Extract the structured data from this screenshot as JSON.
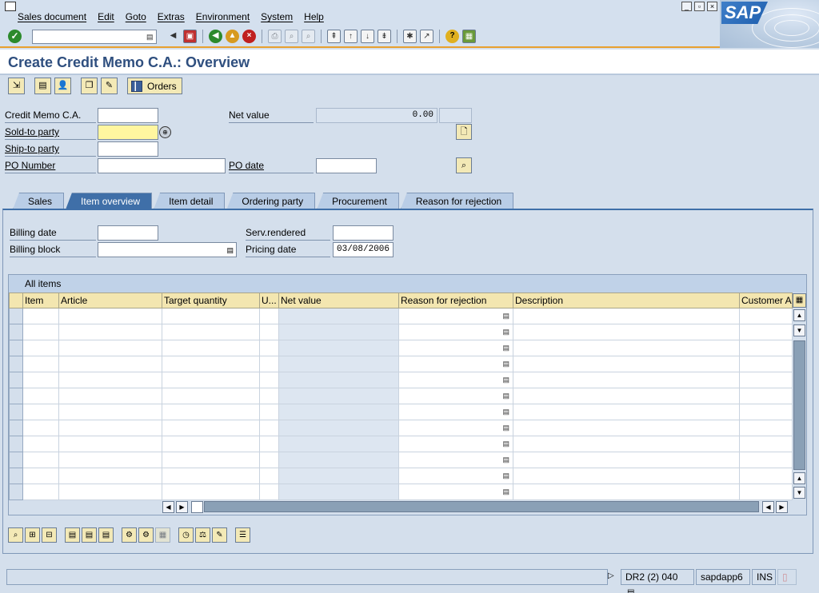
{
  "menu": {
    "items": [
      "Sales document",
      "Edit",
      "Goto",
      "Extras",
      "Environment",
      "System",
      "Help"
    ]
  },
  "logo_text": "SAP",
  "toolbar": {
    "command_field_value": ""
  },
  "page": {
    "title": "Create Credit Memo C.A.: Overview"
  },
  "app_toolbar": {
    "orders_label": "Orders"
  },
  "header": {
    "credit_memo_label": "Credit Memo C.A.",
    "credit_memo_value": "",
    "net_value_label": "Net value",
    "net_value": "0.00",
    "currency_value": "",
    "sold_to_label": "Sold-to party",
    "sold_to_value": "",
    "ship_to_label": "Ship-to party",
    "ship_to_value": "",
    "po_number_label": "PO Number",
    "po_number_value": "",
    "po_date_label": "PO date",
    "po_date_value": ""
  },
  "tabs": [
    {
      "label": "Sales",
      "active": false
    },
    {
      "label": "Item overview",
      "active": true
    },
    {
      "label": "Item detail",
      "active": false
    },
    {
      "label": "Ordering party",
      "active": false
    },
    {
      "label": "Procurement",
      "active": false
    },
    {
      "label": "Reason for rejection",
      "active": false
    }
  ],
  "item_overview": {
    "billing_date_label": "Billing date",
    "billing_date_value": "",
    "serv_rendered_label": "Serv.rendered",
    "serv_rendered_value": "",
    "billing_block_label": "Billing block",
    "billing_block_value": "",
    "pricing_date_label": "Pricing date",
    "pricing_date_value": "03/08/2006"
  },
  "table": {
    "title": "All items",
    "columns": [
      "Item",
      "Article",
      "Target quantity",
      "U...",
      "Net value",
      "Reason for rejection",
      "Description",
      "Customer A"
    ],
    "row_count": 12
  },
  "status": {
    "message": "",
    "system": "DR2 (2) 040",
    "server": "sapdapp6",
    "mode": "INS"
  },
  "colors": {
    "accent_orange": "#e8a02f",
    "title_blue": "#2f4f7f",
    "active_tab": "#3f6fa8",
    "required_field": "#fff6a0"
  }
}
